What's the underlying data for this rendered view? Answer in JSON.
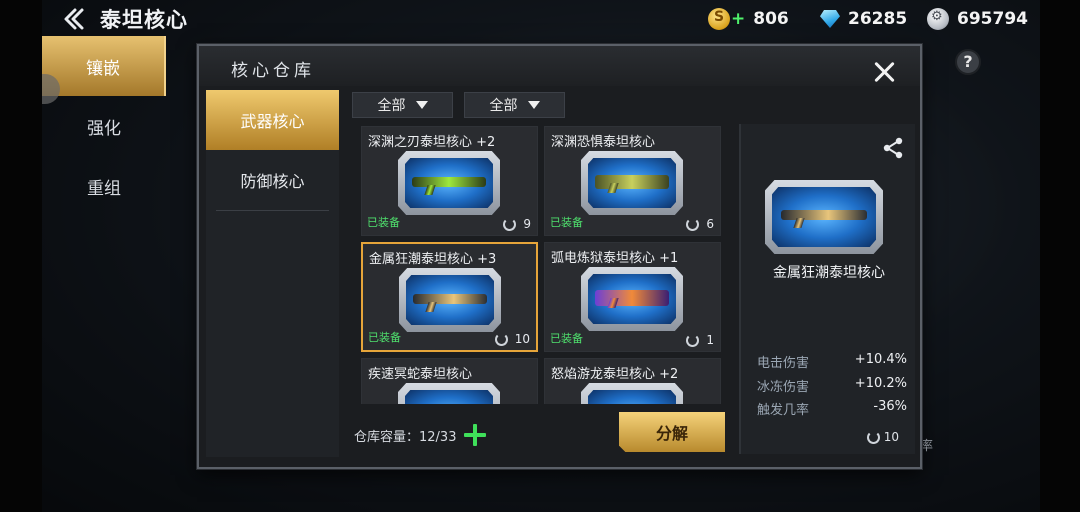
{
  "header": {
    "title": "泰坦核心",
    "currencies": [
      {
        "icon": "gold-coin-icon",
        "value": "806"
      },
      {
        "icon": "diamond-icon",
        "value": "26285"
      },
      {
        "icon": "silver-coin-icon",
        "value": "695794"
      }
    ]
  },
  "left_nav": {
    "items": [
      {
        "label": "镶嵌",
        "active": true
      },
      {
        "label": "强化",
        "active": false
      },
      {
        "label": "重组",
        "active": false
      }
    ]
  },
  "background": {
    "rate_fragment": "率"
  },
  "modal": {
    "title": "核心仓库",
    "tabs": [
      {
        "label": "武器核心",
        "active": true
      },
      {
        "label": "防御核心",
        "active": false
      }
    ],
    "filters": [
      {
        "value": "全部"
      },
      {
        "value": "全部"
      }
    ],
    "cores": [
      {
        "name": "深渊之刃泰坦核心 +2",
        "equipped": "已装备",
        "level": "9",
        "weapon_color": "green"
      },
      {
        "name": "深渊恐惧泰坦核心",
        "equipped": "已装备",
        "level": "6",
        "weapon_color": "olive"
      },
      {
        "name": "金属狂潮泰坦核心 +3",
        "equipped": "已装备",
        "level": "10",
        "weapon_color": "gold",
        "selected": true
      },
      {
        "name": "弧电炼狱泰坦核心 +1",
        "equipped": "已装备",
        "level": "1",
        "weapon_color": "purple"
      },
      {
        "name": "疾速冥蛇泰坦核心",
        "equipped": "",
        "level": ""
      },
      {
        "name": "怒焰游龙泰坦核心 +2",
        "equipped": "",
        "level": ""
      }
    ],
    "capacity_label": "仓库容量：12/33",
    "decompose_label": "分解",
    "detail": {
      "name": "金属狂潮泰坦核心",
      "stats": [
        {
          "label": "电击伤害",
          "value": "+10.4%"
        },
        {
          "label": "冰冻伤害",
          "value": "+10.2%"
        },
        {
          "label": "触发几率",
          "value": "-36%"
        }
      ],
      "level": "10"
    }
  }
}
